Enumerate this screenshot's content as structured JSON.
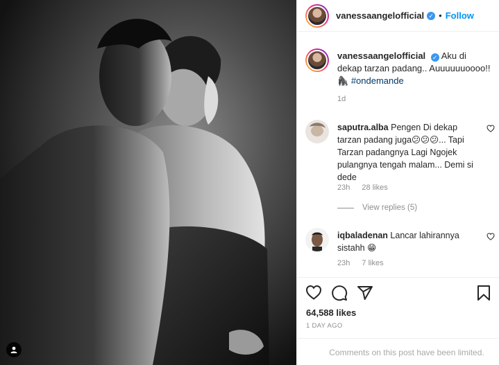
{
  "header": {
    "username": "vanessaangelofficial",
    "separator": "•",
    "follow_label": "Follow"
  },
  "caption": {
    "username": "vanessaangelofficial",
    "text": "Aku di dekap tarzan padang.. Auuuuuuoooo!! 🦍",
    "hashtag": "#ondemande",
    "time": "1d"
  },
  "comments": [
    {
      "username": "saputra.alba",
      "text": "Pengen Di dekap tarzan padang juga😕😕😕... Tapi Tarzan padangnya Lagi Ngojek pulangnya tengah malam... Demi si dede",
      "time": "23h",
      "likes": "28 likes",
      "replies": "View replies (5)"
    },
    {
      "username": "iqbaladenan",
      "text": "Lancar lahirannya sistahh 😁",
      "time": "23h",
      "likes": "7 likes"
    }
  ],
  "footer": {
    "likes": "64,588 likes",
    "date": "1 DAY AGO",
    "comments_limited": "Comments on this post have been limited."
  },
  "icons": {
    "like": "heart-icon",
    "comment": "comment-icon",
    "share": "share-icon",
    "save": "bookmark-icon",
    "tag": "user-tag-icon",
    "verified": "verified-badge-icon"
  },
  "colors": {
    "follow": "#0095f6",
    "verified": "#3897f0",
    "hashtag": "#00376b",
    "muted": "#8e8e8e",
    "border": "#efefef"
  }
}
